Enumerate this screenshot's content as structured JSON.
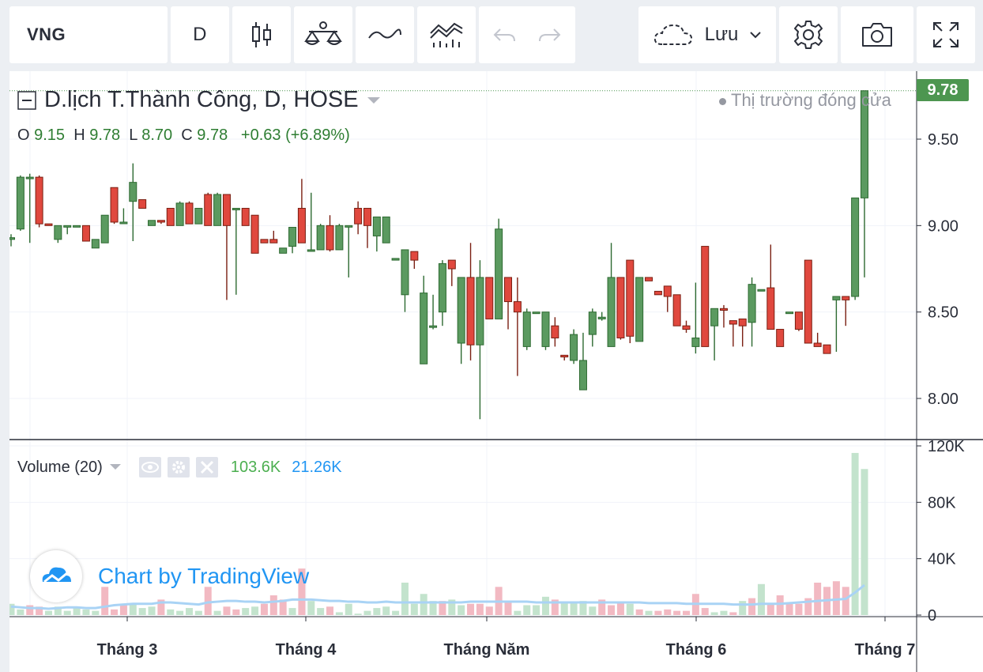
{
  "toolbar": {
    "symbol": "VNG",
    "interval": "D",
    "save_label": "Lưu",
    "icons": [
      "candles-icon",
      "indicators-icon",
      "compare-icon",
      "templates-icon",
      "undo-icon",
      "redo-icon",
      "cloud-icon",
      "chevron-down-icon",
      "settings-icon",
      "camera-icon",
      "fullscreen-icon"
    ]
  },
  "legend": {
    "title": "D.lịch T.Thành Công, D, HOSE",
    "market_status": "Thị trường đóng cửa",
    "o_label": "O",
    "o_value": "9.15",
    "h_label": "H",
    "h_value": "9.78",
    "l_label": "L",
    "l_value": "8.70",
    "c_label": "C",
    "c_value": "9.78",
    "change": "+0.63 (+6.89%)"
  },
  "volume_legend": {
    "name": "Volume (20)",
    "volume": "103.6K",
    "ma": "21.26K"
  },
  "branding": "Chart by TradingView",
  "last_price_tag": "9.78",
  "colors": {
    "up": "#5b9a60",
    "down": "#e0483e",
    "up_volume": "#c3e3cd",
    "down_volume": "#f2b9c2",
    "ma_line": "#a9d3f5",
    "price_tag": "#4d9650"
  },
  "chart_data": {
    "type": "candlestick",
    "y_axis": {
      "ticks": [
        "9.50",
        "9.00",
        "8.50",
        "8.00"
      ],
      "range": [
        7.8,
        9.82
      ]
    },
    "volume_axis": {
      "ticks": [
        "120K",
        "80K",
        "40K",
        "0"
      ],
      "range": [
        0,
        120000
      ]
    },
    "x_axis": {
      "ticks": [
        "Tháng 3",
        "Tháng 4",
        "Tháng Năm",
        "Tháng 6",
        "Tháng 7"
      ]
    },
    "candles": [
      [
        8.92,
        8.95,
        8.88,
        8.93
      ],
      [
        8.98,
        9.29,
        8.97,
        9.28
      ],
      [
        9.28,
        9.3,
        8.9,
        9.28
      ],
      [
        9.28,
        9.29,
        8.99,
        9.01
      ],
      [
        9.01,
        9.01,
        9.0,
        9.0
      ],
      [
        8.92,
        9.0,
        8.9,
        9.0
      ],
      [
        9.0,
        9.0,
        8.95,
        9.0
      ],
      [
        9.0,
        9.0,
        9.0,
        9.0
      ],
      [
        9.0,
        9.0,
        8.91,
        8.91
      ],
      [
        8.87,
        8.92,
        8.87,
        8.92
      ],
      [
        8.9,
        9.06,
        8.9,
        9.06
      ],
      [
        9.22,
        9.22,
        9.01,
        9.02
      ],
      [
        9.02,
        9.1,
        9.02,
        9.02
      ],
      [
        9.14,
        9.36,
        8.91,
        9.25
      ],
      [
        9.15,
        9.15,
        9.1,
        9.1
      ],
      [
        9.0,
        9.03,
        9.0,
        9.03
      ],
      [
        9.03,
        9.03,
        9.01,
        9.02
      ],
      [
        9.1,
        9.1,
        9.0,
        9.0
      ],
      [
        9.0,
        9.14,
        9.0,
        9.13
      ],
      [
        9.13,
        9.14,
        9.01,
        9.01
      ],
      [
        9.01,
        9.1,
        9.01,
        9.1
      ],
      [
        9.18,
        9.19,
        9.0,
        9.0
      ],
      [
        9.0,
        9.19,
        9.0,
        9.18
      ],
      [
        9.18,
        9.18,
        8.57,
        9.0
      ],
      [
        9.1,
        9.1,
        8.6,
        9.1
      ],
      [
        9.1,
        9.1,
        9.0,
        9.0
      ],
      [
        9.06,
        9.06,
        8.84,
        8.84
      ],
      [
        8.92,
        8.92,
        8.9,
        8.9
      ],
      [
        8.92,
        8.97,
        8.9,
        8.9
      ],
      [
        8.84,
        8.87,
        8.84,
        8.87
      ],
      [
        8.88,
        8.98,
        8.84,
        8.99
      ],
      [
        9.1,
        9.27,
        9.0,
        8.9
      ],
      [
        8.86,
        9.19,
        8.85,
        8.86
      ],
      [
        8.86,
        9.01,
        8.86,
        9.0
      ],
      [
        9.0,
        9.06,
        8.85,
        8.86
      ],
      [
        8.86,
        9.01,
        8.86,
        9.0
      ],
      [
        9.0,
        9.0,
        8.7,
        9.0
      ],
      [
        9.1,
        9.14,
        8.95,
        9.01
      ],
      [
        9.1,
        9.1,
        8.87,
        9.0
      ],
      [
        8.94,
        9.0,
        8.85,
        9.05
      ],
      [
        8.9,
        8.94,
        8.9,
        9.05
      ],
      [
        8.8,
        8.8,
        8.8,
        8.81
      ],
      [
        8.6,
        8.85,
        8.5,
        8.86
      ],
      [
        8.85,
        8.85,
        8.75,
        8.8
      ],
      [
        8.2,
        8.71,
        8.2,
        8.61
      ],
      [
        8.42,
        8.6,
        8.4,
        8.42
      ],
      [
        8.5,
        8.8,
        8.42,
        8.78
      ],
      [
        8.8,
        8.8,
        8.65,
        8.75
      ],
      [
        8.32,
        8.7,
        8.2,
        8.7
      ],
      [
        8.7,
        8.9,
        8.22,
        8.31
      ],
      [
        8.31,
        8.8,
        7.88,
        8.7
      ],
      [
        8.7,
        8.7,
        8.46,
        8.46
      ],
      [
        8.46,
        9.04,
        8.46,
        8.98
      ],
      [
        8.7,
        8.7,
        8.4,
        8.56
      ],
      [
        8.56,
        8.7,
        8.13,
        8.5
      ],
      [
        8.3,
        8.52,
        8.28,
        8.5
      ],
      [
        8.5,
        8.5,
        8.5,
        8.5
      ],
      [
        8.3,
        8.5,
        8.28,
        8.5
      ],
      [
        8.42,
        8.47,
        8.3,
        8.35
      ],
      [
        8.25,
        8.25,
        8.22,
        8.24
      ],
      [
        8.22,
        8.4,
        8.2,
        8.37
      ],
      [
        8.05,
        8.38,
        8.05,
        8.22
      ],
      [
        8.37,
        8.52,
        8.3,
        8.5
      ],
      [
        8.46,
        8.5,
        8.45,
        8.47
      ],
      [
        8.3,
        8.9,
        8.3,
        8.7
      ],
      [
        8.7,
        8.7,
        8.34,
        8.35
      ],
      [
        8.8,
        8.8,
        8.32,
        8.36
      ],
      [
        8.33,
        8.7,
        8.33,
        8.7
      ],
      [
        8.7,
        8.7,
        8.7,
        8.68
      ],
      [
        8.62,
        8.62,
        8.6,
        8.6
      ],
      [
        8.65,
        8.65,
        8.5,
        8.59
      ],
      [
        8.6,
        8.6,
        8.42,
        8.42
      ],
      [
        8.42,
        8.45,
        8.38,
        8.4
      ],
      [
        8.3,
        8.67,
        8.26,
        8.35
      ],
      [
        8.88,
        8.88,
        8.3,
        8.3
      ],
      [
        8.42,
        8.52,
        8.22,
        8.52
      ],
      [
        8.52,
        8.54,
        8.41,
        8.51
      ],
      [
        8.45,
        8.45,
        8.3,
        8.43
      ],
      [
        8.46,
        8.46,
        8.3,
        8.42
      ],
      [
        8.44,
        8.7,
        8.3,
        8.66
      ],
      [
        8.63,
        8.63,
        8.63,
        8.63
      ],
      [
        8.64,
        8.89,
        8.41,
        8.4
      ],
      [
        8.4,
        8.4,
        8.3,
        8.3
      ],
      [
        8.5,
        8.5,
        8.49,
        8.5
      ],
      [
        8.5,
        8.5,
        8.39,
        8.4
      ],
      [
        8.8,
        8.8,
        8.32,
        8.32
      ],
      [
        8.32,
        8.38,
        8.3,
        8.3
      ],
      [
        8.31,
        8.31,
        8.27,
        8.26
      ],
      [
        8.57,
        8.59,
        8.27,
        8.59
      ],
      [
        8.59,
        8.59,
        8.42,
        8.57
      ],
      [
        8.59,
        9.16,
        8.57,
        9.16
      ],
      [
        9.16,
        9.78,
        8.7,
        9.78
      ]
    ],
    "volume": [
      [
        "u",
        8000
      ],
      [
        "u",
        4000
      ],
      [
        "d",
        7000
      ],
      [
        "d",
        6000
      ],
      [
        "u",
        3000
      ],
      [
        "u",
        6000
      ],
      [
        "u",
        3000
      ],
      [
        "u",
        5000
      ],
      [
        "u",
        4000
      ],
      [
        "u",
        3000
      ],
      [
        "d",
        20000
      ],
      [
        "d",
        4000
      ],
      [
        "d",
        7000
      ],
      [
        "u",
        8000
      ],
      [
        "u",
        5000
      ],
      [
        "u",
        6000
      ],
      [
        "d",
        11000
      ],
      [
        "u",
        4000
      ],
      [
        "u",
        3000
      ],
      [
        "u",
        5000
      ],
      [
        "u",
        3000
      ],
      [
        "d",
        20000
      ],
      [
        "u",
        3000
      ],
      [
        "d",
        6000
      ],
      [
        "d",
        4000
      ],
      [
        "u",
        5000
      ],
      [
        "u",
        6000
      ],
      [
        "d",
        8000
      ],
      [
        "d",
        14000
      ],
      [
        "d",
        11000
      ],
      [
        "u",
        5000
      ],
      [
        "d",
        33000
      ],
      [
        "u",
        10000
      ],
      [
        "u",
        5000
      ],
      [
        "d",
        6000
      ],
      [
        "u",
        2000
      ],
      [
        "u",
        8000
      ],
      [
        "u",
        1000
      ],
      [
        "u",
        3000
      ],
      [
        "u",
        5000
      ],
      [
        "u",
        6000
      ],
      [
        "u",
        3000
      ],
      [
        "u",
        23000
      ],
      [
        "u",
        8000
      ],
      [
        "u",
        15000
      ],
      [
        "u",
        10000
      ],
      [
        "d",
        10000
      ],
      [
        "u",
        11000
      ],
      [
        "u",
        7000
      ],
      [
        "d",
        8000
      ],
      [
        "d",
        8000
      ],
      [
        "d",
        6000
      ],
      [
        "d",
        20000
      ],
      [
        "d",
        9000
      ],
      [
        "u",
        3000
      ],
      [
        "u",
        7000
      ],
      [
        "u",
        7000
      ],
      [
        "u",
        13000
      ],
      [
        "d",
        11000
      ],
      [
        "u",
        9000
      ],
      [
        "u",
        9000
      ],
      [
        "u",
        10000
      ],
      [
        "u",
        6000
      ],
      [
        "d",
        11000
      ],
      [
        "d",
        7000
      ],
      [
        "d",
        9000
      ],
      [
        "u",
        8000
      ],
      [
        "d",
        4000
      ],
      [
        "u",
        3000
      ],
      [
        "d",
        3000
      ],
      [
        "d",
        4000
      ],
      [
        "d",
        3000
      ],
      [
        "d",
        3000
      ],
      [
        "d",
        15000
      ],
      [
        "d",
        5000
      ],
      [
        "u",
        2000
      ],
      [
        "u",
        3000
      ],
      [
        "d",
        2000
      ],
      [
        "u",
        10000
      ],
      [
        "d",
        12000
      ],
      [
        "u",
        22000
      ],
      [
        "d",
        8000
      ],
      [
        "d",
        14000
      ],
      [
        "d",
        8000
      ],
      [
        "d",
        8000
      ],
      [
        "d",
        12000
      ],
      [
        "d",
        23000
      ],
      [
        "d",
        20000
      ],
      [
        "d",
        24000
      ],
      [
        "d",
        20000
      ],
      [
        "u",
        115000
      ],
      [
        "u",
        103600
      ]
    ],
    "volume_ma": [
      6000,
      5500,
      5000,
      5000,
      4500,
      5000,
      5500,
      5500,
      5000,
      5000,
      6000,
      7000,
      7500,
      8000,
      8000,
      8000,
      9000,
      9000,
      8500,
      8000,
      7500,
      9000,
      9500,
      10000,
      10000,
      9500,
      9500,
      9000,
      9500,
      10000,
      11000,
      11000,
      11000,
      10500,
      10000,
      10000,
      9500,
      9500,
      9000,
      9000,
      9500,
      9000,
      9000,
      9000,
      9000,
      9000,
      9000,
      9000,
      9000,
      9500,
      9500,
      9500,
      9500,
      9500,
      9500,
      9500,
      9000,
      9000,
      9000,
      9000,
      9000,
      9000,
      9000,
      9000,
      9000,
      9000,
      9000,
      9000,
      8500,
      8500,
      8500,
      8500,
      8000,
      8000,
      8000,
      8000,
      8000,
      7500,
      7500,
      7500,
      8000,
      8000,
      8000,
      8500,
      9000,
      9500,
      10000,
      10500,
      11000,
      11500,
      16000,
      21260
    ]
  }
}
